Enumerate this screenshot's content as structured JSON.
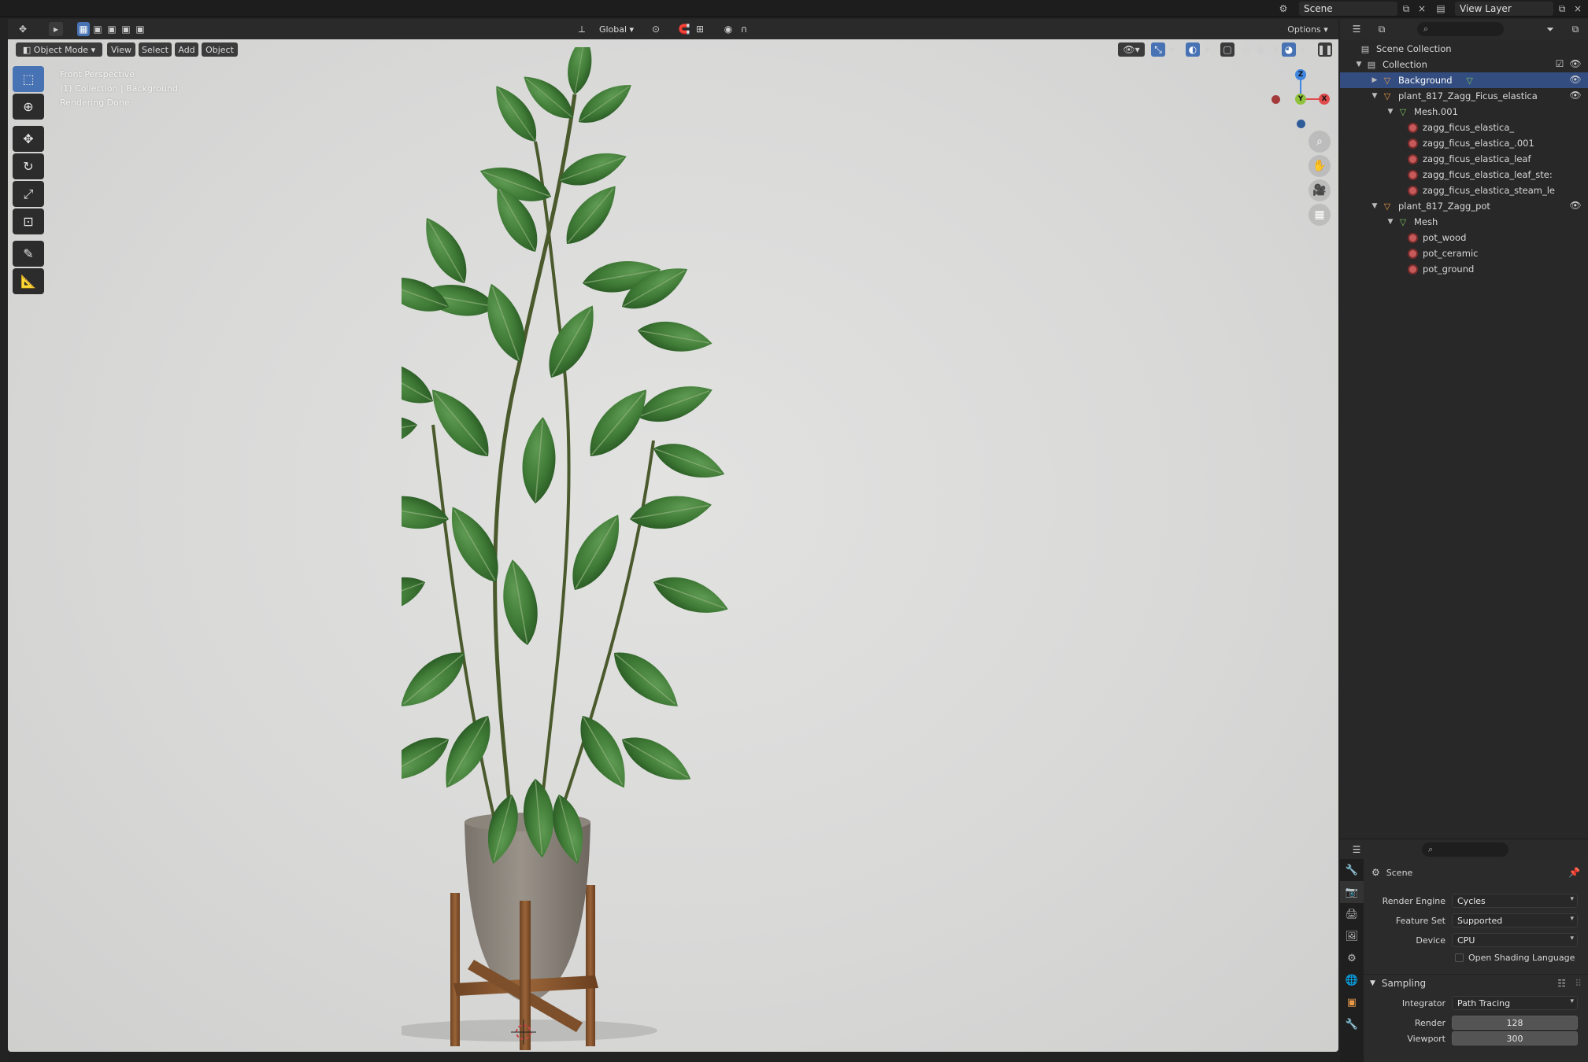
{
  "topbar": {
    "scene_name": "Scene",
    "view_layer": "View Layer"
  },
  "viewport_header": {
    "mode": "Object Mode",
    "menu": [
      "View",
      "Select",
      "Add",
      "Object"
    ],
    "transform_orientation": "Global",
    "options": "Options"
  },
  "viewport": {
    "perspective": "Front Perspective",
    "collection_info": "(1) Collection | Background",
    "status": "Rendering Done",
    "gizmo": {
      "z": "Z",
      "y": "Y",
      "x": "X"
    }
  },
  "outliner": {
    "items": [
      {
        "label": "Scene Collection",
        "type": "scene-collection"
      },
      {
        "label": "Collection",
        "type": "collection"
      },
      {
        "label": "Background",
        "type": "object",
        "selected": true
      },
      {
        "label": "plant_817_Zagg_Ficus_elastica",
        "type": "object"
      },
      {
        "label": "Mesh.001",
        "type": "mesh"
      },
      {
        "label": "zagg_ficus_elastica_",
        "type": "material"
      },
      {
        "label": "zagg_ficus_elastica_.001",
        "type": "material"
      },
      {
        "label": "zagg_ficus_elastica_leaf",
        "type": "material"
      },
      {
        "label": "zagg_ficus_elastica_leaf_ste:",
        "type": "material"
      },
      {
        "label": "zagg_ficus_elastica_steam_le",
        "type": "material"
      },
      {
        "label": "plant_817_Zagg_pot",
        "type": "object"
      },
      {
        "label": "Mesh",
        "type": "mesh"
      },
      {
        "label": "pot_wood",
        "type": "material"
      },
      {
        "label": "pot_ceramic",
        "type": "material"
      },
      {
        "label": "pot_ground",
        "type": "material"
      }
    ]
  },
  "properties": {
    "context": "Scene",
    "render_engine_label": "Render Engine",
    "render_engine": "Cycles",
    "feature_set_label": "Feature Set",
    "feature_set": "Supported",
    "device_label": "Device",
    "device": "CPU",
    "osl_label": "Open Shading Language",
    "sampling_label": "Sampling",
    "integrator_label": "Integrator",
    "integrator": "Path Tracing",
    "render_label": "Render",
    "render_samples": "128",
    "viewport_label": "Viewport",
    "viewport_samples": "300"
  },
  "colors": {
    "accent": "#4772b3",
    "selection": "#334d80",
    "axis_x": "#e04b4b",
    "axis_y": "#8fc23a",
    "axis_z": "#3f86e0"
  }
}
